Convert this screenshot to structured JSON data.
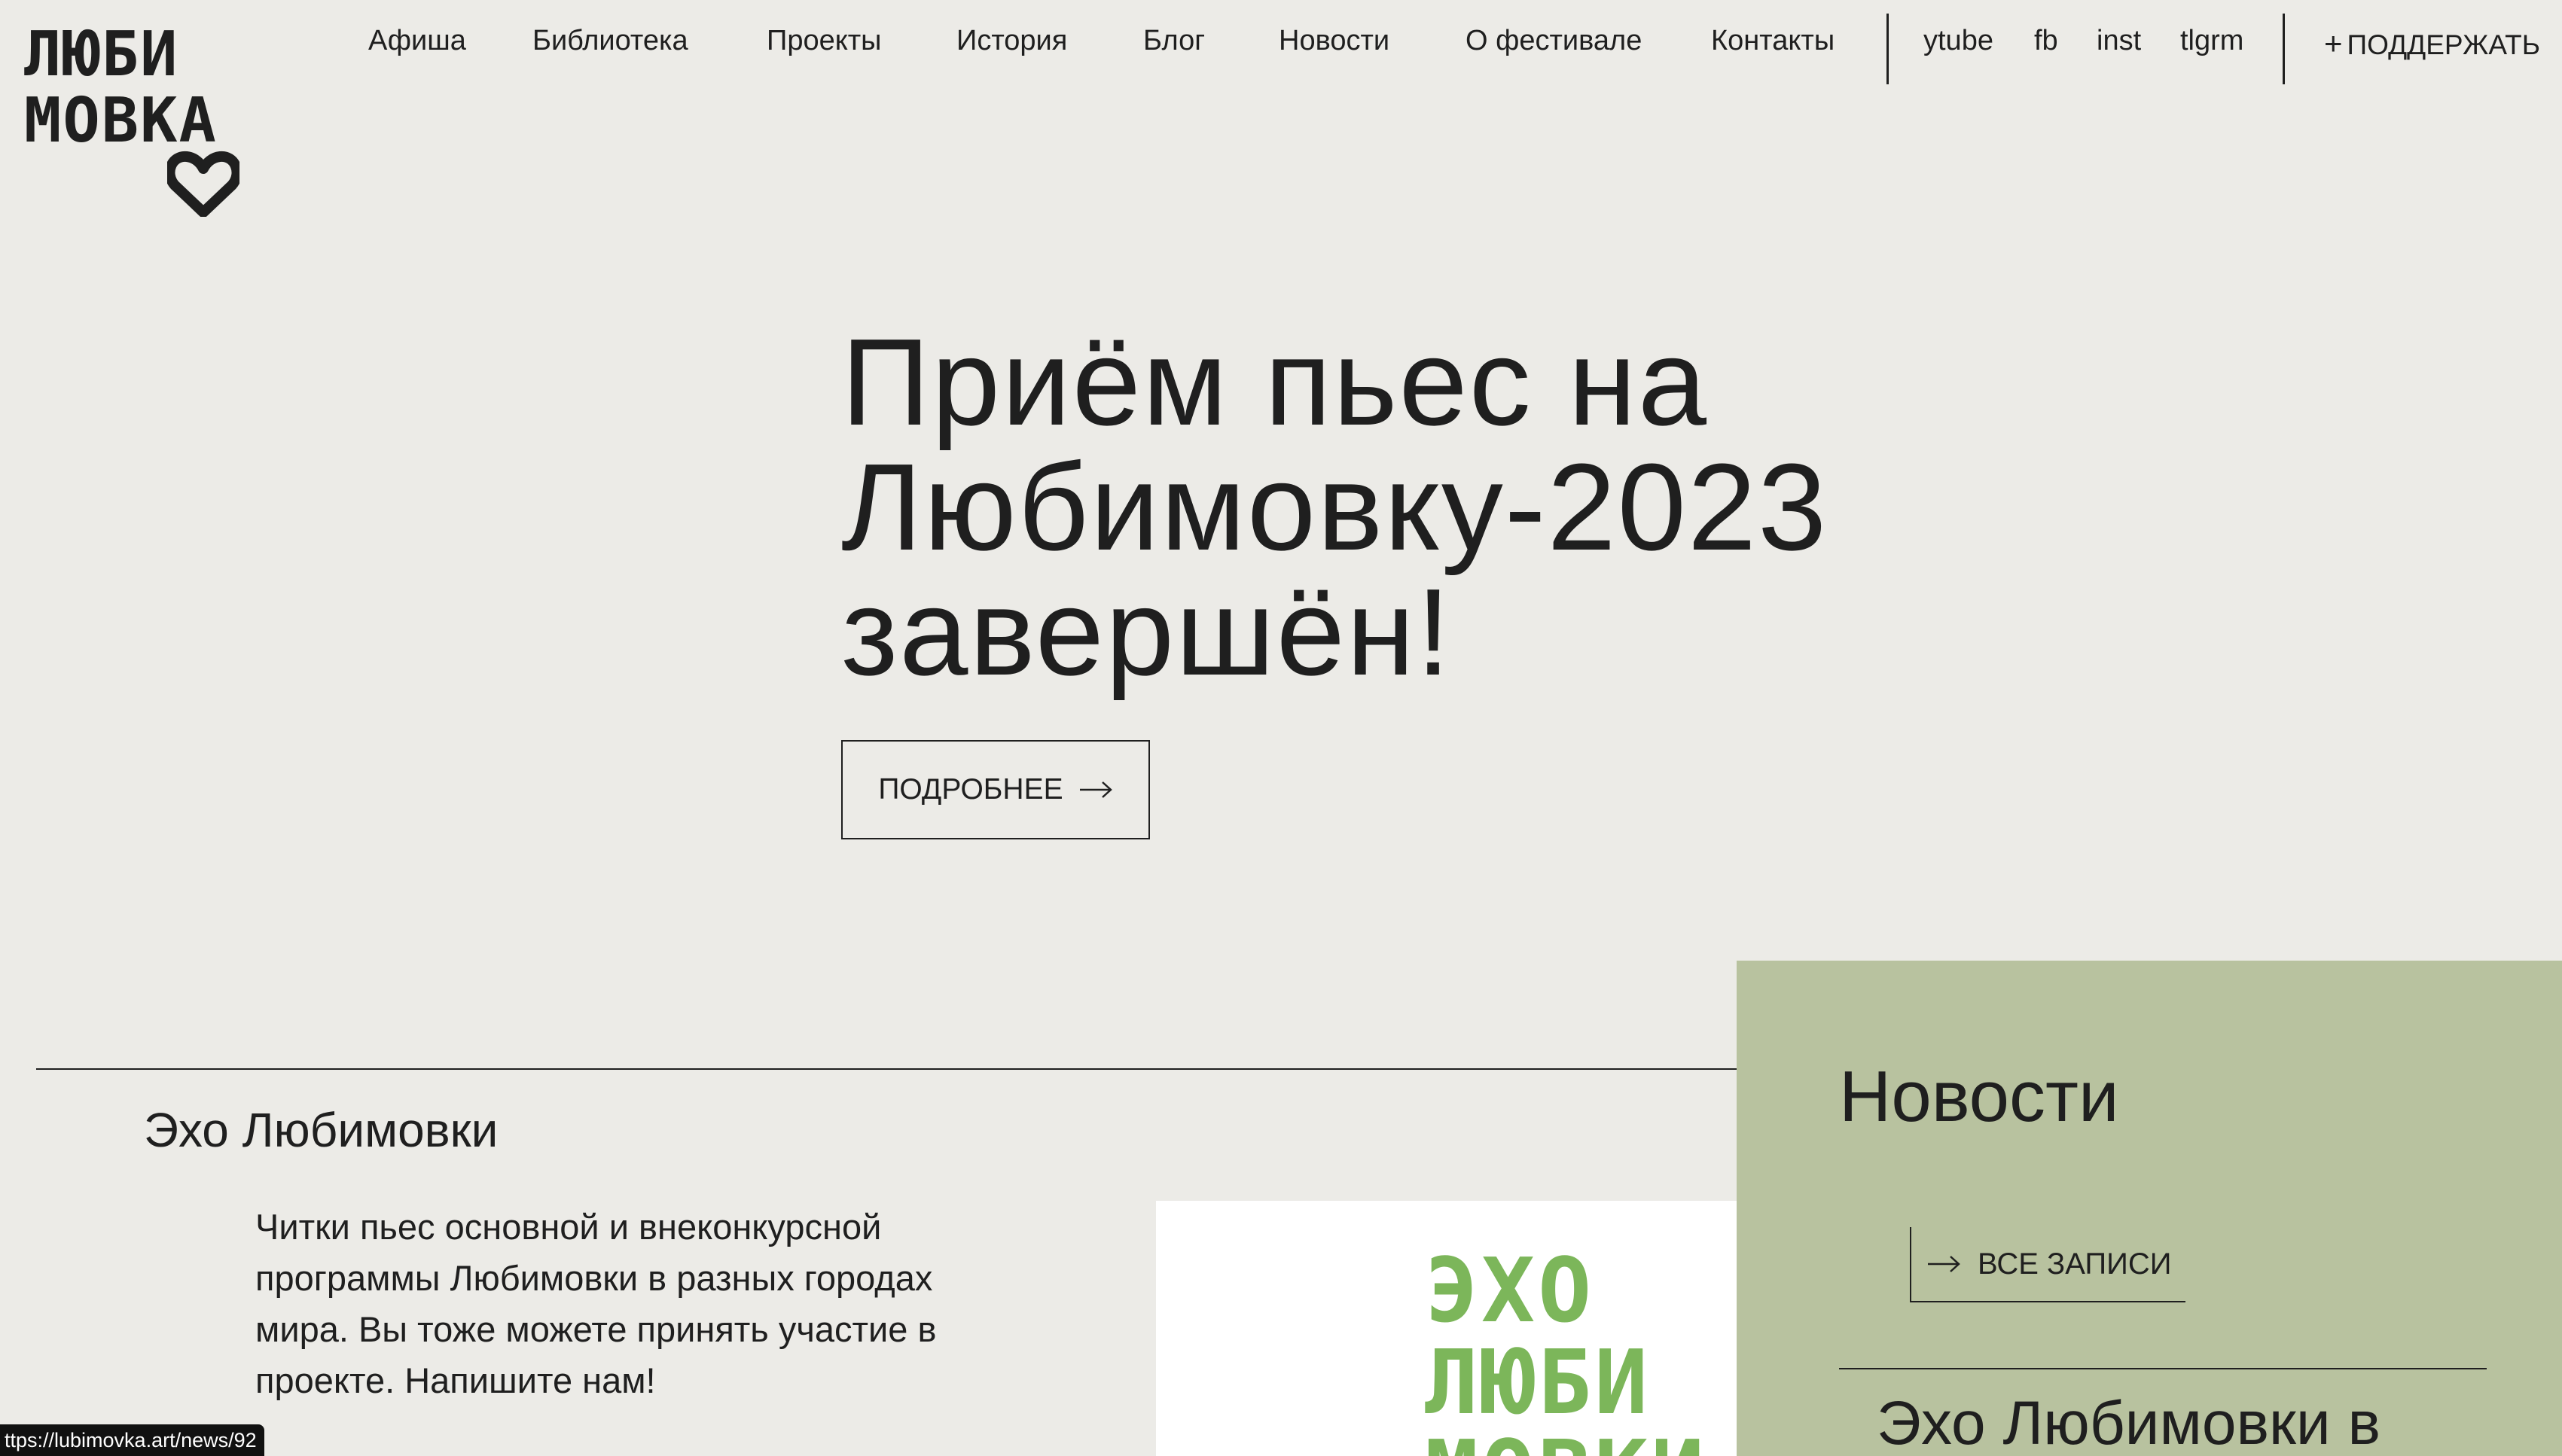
{
  "logo": {
    "line1": "ЛЮБИ",
    "line2": "МОВКА"
  },
  "nav": {
    "items": [
      "Афиша",
      "Библиотека",
      "Проекты",
      "История",
      "Блог",
      "Новости",
      "О фестивале",
      "Контакты"
    ],
    "social": [
      "ytube",
      "fb",
      "inst",
      "tlgrm"
    ],
    "support_label": "ПОДДЕРЖАТЬ"
  },
  "hero": {
    "title": "Приём пьес на Любимовку-2023 завершён!",
    "button_label": "ПОДРОБНЕЕ"
  },
  "echo": {
    "title": "Эхо Любимовки",
    "text": "Читки пьес основной и внеконкурсной программы Любимовки в разных городах мира. Вы тоже можете принять участие в проекте. Напишите нам!",
    "image_lines": [
      "ЭХО",
      "ЛЮБИ",
      "МОВКИ"
    ]
  },
  "news": {
    "title": "Новости",
    "all_label": "ВСЕ ЗАПИСИ",
    "first_item_title": "Эхо Любимовки в"
  },
  "status": {
    "url": "ttps://lubimovka.art/news/92"
  },
  "colors": {
    "background": "#ecebe7",
    "text": "#1f1f1f",
    "news_panel": "#b8c29f",
    "echo_logo_green": "#7cb65a"
  }
}
